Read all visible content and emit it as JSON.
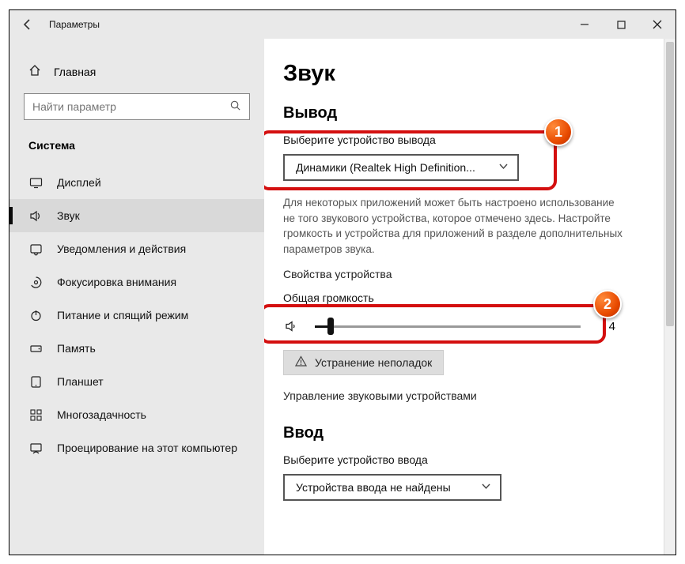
{
  "window": {
    "title": "Параметры"
  },
  "sidebar": {
    "home": "Главная",
    "search_placeholder": "Найти параметр",
    "section": "Система",
    "items": [
      {
        "label": "Дисплей"
      },
      {
        "label": "Звук"
      },
      {
        "label": "Уведомления и действия"
      },
      {
        "label": "Фокусировка внимания"
      },
      {
        "label": "Питание и спящий режим"
      },
      {
        "label": "Память"
      },
      {
        "label": "Планшет"
      },
      {
        "label": "Многозадачность"
      },
      {
        "label": "Проецирование на этот компьютер"
      }
    ]
  },
  "main": {
    "page_title": "Звук",
    "output": {
      "heading": "Вывод",
      "select_label": "Выберите устройство вывода",
      "selected": "Динамики (Realtek High Definition...",
      "help": "Для некоторых приложений может быть настроено использование не того звукового устройства, которое отмечено здесь. Настройте громкость и устройства для приложений в разделе дополнительных параметров звука.",
      "properties": "Свойства устройства",
      "volume_label": "Общая громкость",
      "volume_value": "4",
      "volume_fill_percent": 6,
      "troubleshoot": "Устранение неполадок",
      "manage": "Управление звуковыми устройствами"
    },
    "input": {
      "heading": "Ввод",
      "select_label": "Выберите устройство ввода",
      "selected": "Устройства ввода не найдены"
    }
  },
  "annotations": {
    "badge1": "1",
    "badge2": "2"
  }
}
